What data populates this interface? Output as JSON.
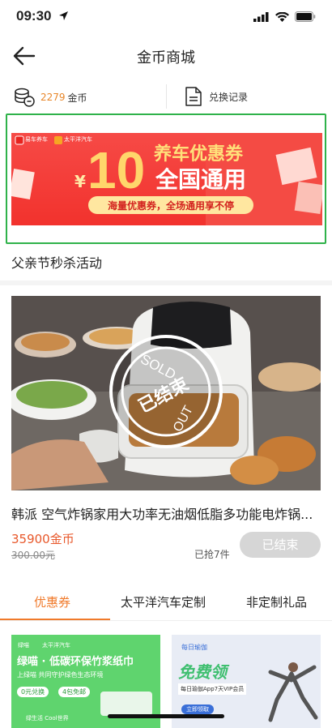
{
  "status": {
    "time": "09:30"
  },
  "nav": {
    "title": "金币商城"
  },
  "coins": {
    "amount": "2279",
    "unit": "金币"
  },
  "exchange": {
    "label": "兑换记录"
  },
  "banner": {
    "logo1": "易车养车",
    "logo2": "太平洋汽车",
    "currency": "¥",
    "amount": "10",
    "line1": "养车优惠券",
    "line2": "全国通用",
    "slogan": "海量优惠券，全场通用享不停"
  },
  "section": {
    "title": "父亲节秒杀活动"
  },
  "product": {
    "stamp_top": "SOLD",
    "stamp_mid": "已结束",
    "stamp_bottom": "OUT",
    "name": "韩派 空气炸锅家用大功率无油烟低脂多功能电炸锅...",
    "price": "35900金币",
    "original_price": "300.00元",
    "sold": "已抢7件",
    "button": "已结束"
  },
  "tabs": [
    {
      "label": "优惠券"
    },
    {
      "label": "太平洋汽车定制"
    },
    {
      "label": "非定制礼品"
    }
  ],
  "cards": {
    "left": {
      "brand1": "绿喵",
      "brand2": "太平洋汽车",
      "title": "绿喵 · 低碳环保竹浆纸巾",
      "subtitle": "上绿喵 共同守护绿色生态环境",
      "tag1": "0元兑换",
      "tag2": "4包免邮",
      "footer": "绿生活 Cool世界"
    },
    "right": {
      "brand": "每日瑜伽",
      "title": "免费领",
      "subtitle": "每日瑜伽App7天VIP会员",
      "button": "立即领取"
    }
  },
  "colors": {
    "accent": "#f07a2b",
    "banner_red": "#f2322d",
    "highlight_border": "#2fb24a"
  }
}
